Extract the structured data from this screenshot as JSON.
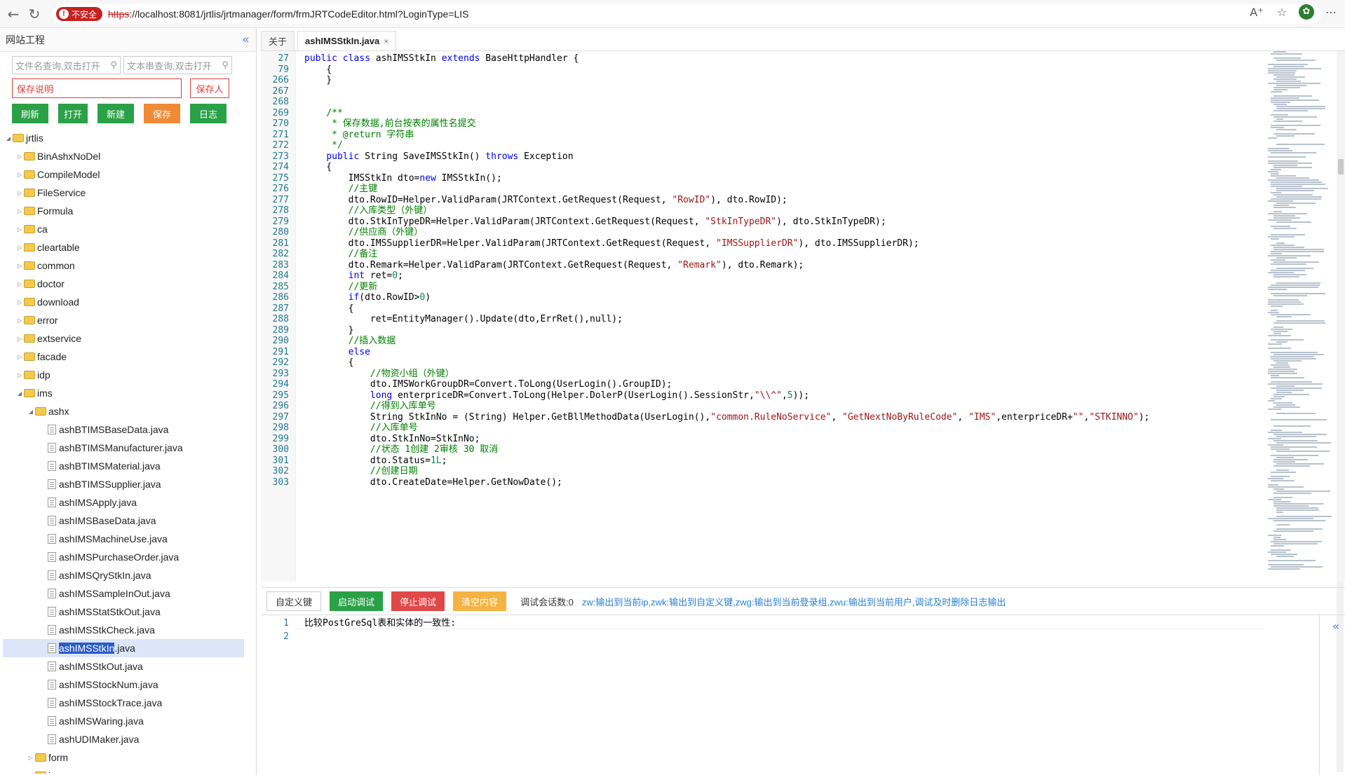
{
  "browser": {
    "insecure_label": "不安全",
    "url_scheme": "https",
    "url_rest": "://localhost:8081/jrtlis/jrtmanager/form/frmJRTCodeEditor.html?LoginType=LIS"
  },
  "left_panel": {
    "title": "网站工程",
    "file_search_placeholder": "文件名查询,双击打开",
    "text_search_placeholder": "文本串查询,双击打开",
    "save_desc_placeholder": "保存说明",
    "save_person_placeholder": "保存人",
    "buttons": [
      "刷新",
      "打开",
      "新建",
      "保存",
      "日志"
    ]
  },
  "tree": [
    {
      "label": "jrtlis",
      "depth": 0,
      "type": "folder",
      "open": true
    },
    {
      "label": "BinAshxNoDel",
      "depth": 1,
      "type": "folder"
    },
    {
      "label": "CompileModel",
      "depth": 1,
      "type": "folder"
    },
    {
      "label": "FileService",
      "depth": 1,
      "type": "folder"
    },
    {
      "label": "Formula",
      "depth": 1,
      "type": "folder"
    },
    {
      "label": "ca",
      "depth": 1,
      "type": "folder"
    },
    {
      "label": "cleartable",
      "depth": 1,
      "type": "folder"
    },
    {
      "label": "common",
      "depth": 1,
      "type": "folder"
    },
    {
      "label": "doctor",
      "depth": 1,
      "type": "folder"
    },
    {
      "label": "download",
      "depth": 1,
      "type": "folder"
    },
    {
      "label": "error",
      "depth": 1,
      "type": "folder"
    },
    {
      "label": "extservice",
      "depth": 1,
      "type": "folder"
    },
    {
      "label": "facade",
      "depth": 1,
      "type": "folder"
    },
    {
      "label": "idp",
      "depth": 1,
      "type": "folder"
    },
    {
      "label": "ims",
      "depth": 1,
      "type": "folder",
      "open": true
    },
    {
      "label": "ashx",
      "depth": 2,
      "type": "folder",
      "open": true
    },
    {
      "label": "ashBTIMSBaseData.java",
      "depth": 3,
      "type": "file"
    },
    {
      "label": "ashBTIMSManufacturer.java",
      "depth": 3,
      "type": "file"
    },
    {
      "label": "ashBTIMSMaterial.java",
      "depth": 3,
      "type": "file"
    },
    {
      "label": "ashBTIMSSupplier.java",
      "depth": 3,
      "type": "file"
    },
    {
      "label": "ashIMSApply.java",
      "depth": 3,
      "type": "file"
    },
    {
      "label": "ashIMSBaseData.java",
      "depth": 3,
      "type": "file"
    },
    {
      "label": "ashIMSMachineUse.java",
      "depth": 3,
      "type": "file"
    },
    {
      "label": "ashIMSPurchaseOrder.java",
      "depth": 3,
      "type": "file"
    },
    {
      "label": "ashIMSQryStkIn.java",
      "depth": 3,
      "type": "file"
    },
    {
      "label": "ashIMSSampleInOut.java",
      "depth": 3,
      "type": "file"
    },
    {
      "label": "ashIMSStatStkOut.java",
      "depth": 3,
      "type": "file"
    },
    {
      "label": "ashIMSStkCheck.java",
      "depth": 3,
      "type": "file"
    },
    {
      "label": "ashIMSStkIn.java",
      "depth": 3,
      "type": "file",
      "selected": true
    },
    {
      "label": "ashIMSStkOut.java",
      "depth": 3,
      "type": "file"
    },
    {
      "label": "ashIMSStockNum.java",
      "depth": 3,
      "type": "file"
    },
    {
      "label": "ashIMSStockTrace.java",
      "depth": 3,
      "type": "file"
    },
    {
      "label": "ashIMSWaring.java",
      "depth": 3,
      "type": "file"
    },
    {
      "label": "ashUDIMaker.java",
      "depth": 3,
      "type": "file"
    },
    {
      "label": "form",
      "depth": 2,
      "type": "folder"
    },
    {
      "label": "js",
      "depth": 2,
      "type": "folder"
    }
  ],
  "tabs": [
    {
      "label": "关于",
      "active": false
    },
    {
      "label": "ashIMSStkIn.java",
      "active": true,
      "close": "×"
    }
  ],
  "code": [
    {
      "ln": "27",
      "html": "<span class='kw'>public</span> <span class='kw'>class</span> ashIMSStkIn <span class='kw'>extends</span> BaseHttpHandler {"
    },
    {
      "ln": "79",
      "html": "    {"
    },
    {
      "ln": "266",
      "html": "    }"
    },
    {
      "ln": "267",
      "html": ""
    },
    {
      "ln": "268",
      "html": ""
    },
    {
      "ln": "269",
      "html": "    <span class='cm'>/**</span>"
    },
    {
      "ln": "270",
      "html": "    <span class='cm'> * 保存数据,前台按表的属性名提交</span>"
    },
    {
      "ln": "271",
      "html": "    <span class='cm'> * @return 字符串</span>"
    },
    {
      "ln": "272",
      "html": "    <span class='cm'> */</span>"
    },
    {
      "ln": "273",
      "html": "    <span class='kw'>public</span> String SaveIMSStkIn() <span class='kw'>throws</span> Exception"
    },
    {
      "ln": "274",
      "html": "    {"
    },
    {
      "ln": "275",
      "html": "        IMSStkIn dto=<span class='kw'>new</span> IMSStkIn();"
    },
    {
      "ln": "276",
      "html": "        <span class='cm'>//主键</span>"
    },
    {
      "ln": "277",
      "html": "        dto.RowID=Helper.ValidParam(JRTContext.GetRequest(Request, <span class='st'>\"RowID\"</span>), dto.RowID);"
    },
    {
      "ln": "278",
      "html": "        <span class='cm'>//入库类型（外键）</span>"
    },
    {
      "ln": "279",
      "html": "        dto.StkInTypeDR=Helper.ValidParam(JRTContext.GetRequest(Request, <span class='st'>\"StkInTypeDR\"</span>), dto.StkInTypeDR);"
    },
    {
      "ln": "280",
      "html": "        <span class='cm'>//供应商（外键）</span>"
    },
    {
      "ln": "281",
      "html": "        dto.IMSSupplierDR=Helper.ValidParam(JRTContext.GetRequest(Request, <span class='st'>\"IMSSupplierDR\"</span>), dto.IMSSupplierDR);"
    },
    {
      "ln": "282",
      "html": "        <span class='cm'>//备注</span>"
    },
    {
      "ln": "283",
      "html": "        dto.Remark=Helper.ValidParam(JRTContext.GetRequest(Request, <span class='st'>\"Remark\"</span>), dto.Remark);"
    },
    {
      "ln": "284",
      "html": "        <span class='kw'>int</span> ret=<span class='nm'>0</span>;"
    },
    {
      "ln": "285",
      "html": "        <span class='cm'>//更新</span>"
    },
    {
      "ln": "286",
      "html": "        <span class='kw'>if</span>(dto.RowID&gt;<span class='nm'>0</span>)"
    },
    {
      "ln": "287",
      "html": "        {"
    },
    {
      "ln": "288",
      "html": "            ret=EntityManager().Update(dto,ErrRet(),null);"
    },
    {
      "ln": "289",
      "html": "        }"
    },
    {
      "ln": "290",
      "html": "        <span class='cm'>//插入数据</span>"
    },
    {
      "ln": "291",
      "html": "        <span class='kw'>else</span>"
    },
    {
      "ln": "292",
      "html": "        {"
    },
    {
      "ln": "293",
      "html": "            <span class='cm'>//物资小组（外键）</span>"
    },
    {
      "ln": "294",
      "html": "            dto.IMSWorkGroupDR=Convert.ToLong(UserLogin().GroupID);"
    },
    {
      "ln": "295",
      "html": "            <span class='kw'>long</span> enterpriceDR=Convert.ToLong(Helper.DolerP(UserLogin().SessionStr,<span class='st'>\"\\\\^\"</span>,<span class='nm'>5</span>));"
    },
    {
      "ln": "296",
      "html": "            <span class='cm'>//得到入库单号</span>"
    },
    {
      "ln": "297",
      "html": "            String StkInNo = (String) Helper.GetBllMethodData(UserLogin(),<span class='st'>\"common.RuleNoService\"</span>, <span class='st'>\"GetNextNoByRuleCode\"</span>, <span class='st'>\"IMS\"</span>,enterpriceDR+<span class='st'>\"\"</span>,<span class='st'>\"STKINNO\"</span>);"
    },
    {
      "ln": "298",
      "html": "            <span class='cm'>//入库单号</span>"
    },
    {
      "ln": "299",
      "html": "            dto.StkInNo=StkInNo;"
    },
    {
      "ln": "300",
      "html": "            <span class='cm'>//状态 1创建 2审核 30 取消</span>"
    },
    {
      "ln": "301",
      "html": "            dto.Status=<span class='nm'>1L</span>;"
    },
    {
      "ln": "302",
      "html": "            <span class='cm'>//创建日期</span>"
    },
    {
      "ln": "303",
      "html": "            dto.CreateDate=Helper.GetNowDate();"
    }
  ],
  "debug": {
    "custom_key": "自定义键",
    "start": "启动调试",
    "stop": "停止调试",
    "clear": "清空内容",
    "session_count": "调试会话数:0",
    "hint": "zw:输出到当前ip,zwk:输出到自定义键,zwg:输出到当前登录组,zwu:输出到当前用户,调试及时删除日志输出"
  },
  "output": [
    {
      "ln": "1",
      "text": "比较PostGreSql表和实体的一致性:"
    },
    {
      "ln": "2",
      "text": ""
    }
  ],
  "colors": {
    "green": "#2aa146",
    "orange": "#f08a34",
    "red": "#e04848",
    "yellow": "#f5b342",
    "accent": "#2a5cc9"
  }
}
